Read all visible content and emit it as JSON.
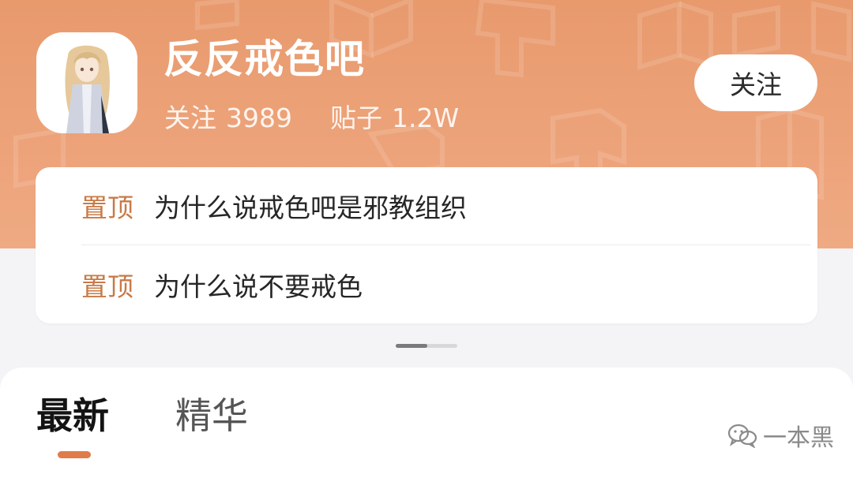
{
  "forum": {
    "title": "反反戒色吧",
    "stats": {
      "follow_label": "关注",
      "follow_count": "3989",
      "posts_label": "贴子",
      "posts_count": "1.2W"
    },
    "follow_button": "关注",
    "avatar_icon": "anime-girl-avatar"
  },
  "pinned": [
    {
      "tag": "置顶",
      "text": "为什么说戒色吧是邪教组织"
    },
    {
      "tag": "置顶",
      "text": "为什么说不要戒色"
    }
  ],
  "tabs": [
    {
      "label": "最新",
      "active": true
    },
    {
      "label": "精华",
      "active": false
    }
  ],
  "watermark": {
    "text": "一本黑",
    "icon": "wechat-icon"
  },
  "colors": {
    "banner": "#eda37a",
    "accent": "#e07c4a",
    "pin_tag": "#c87a47"
  }
}
